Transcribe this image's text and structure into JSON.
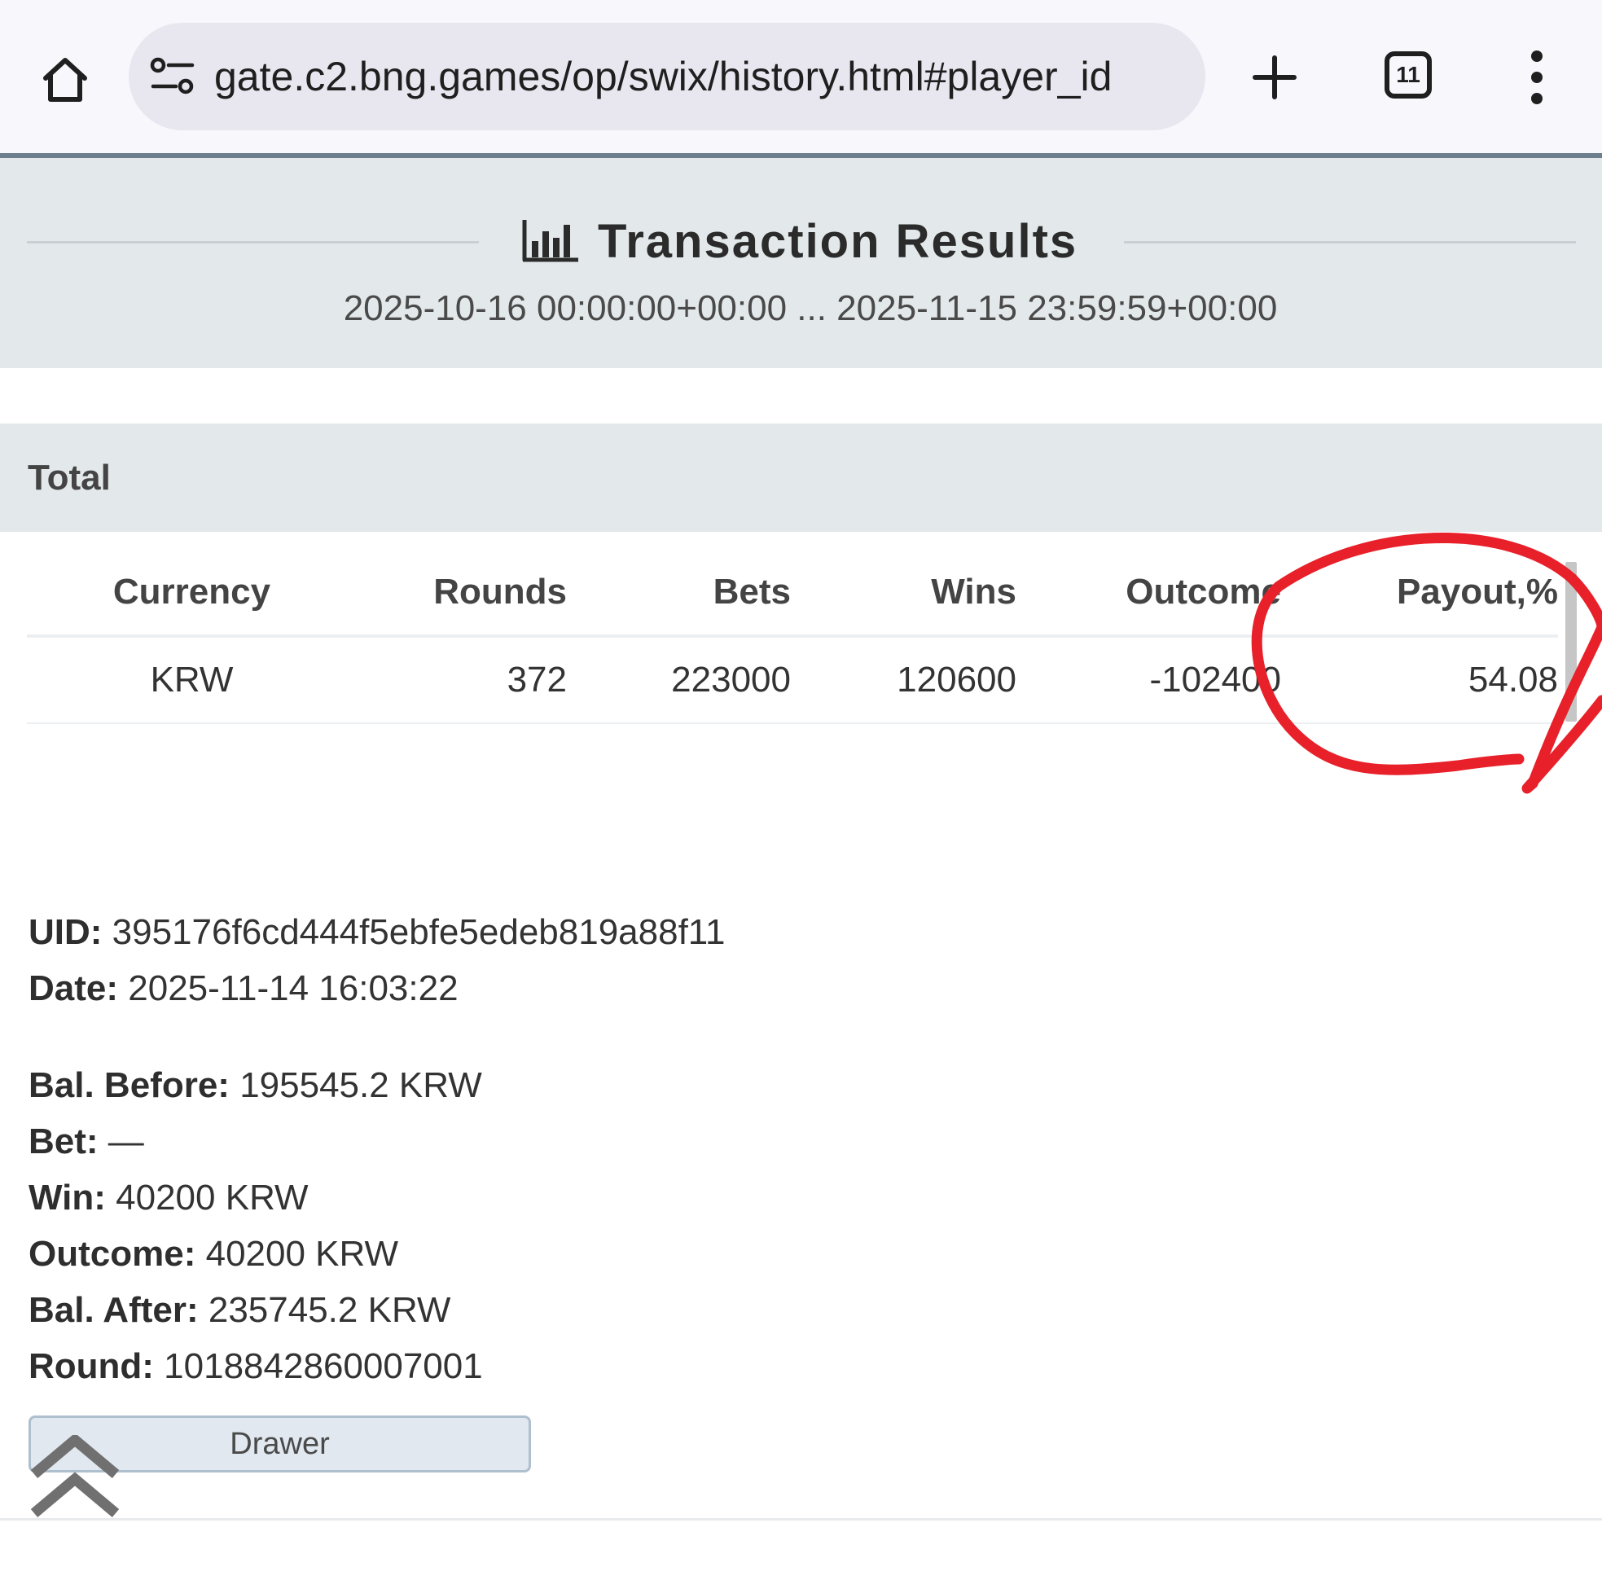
{
  "browser": {
    "url": "gate.c2.bng.games/op/swix/history.html#player_id",
    "tab_count": "11",
    "icons": [
      "home-icon",
      "tune-icon",
      "plus-icon",
      "tab-switcher-icon",
      "more-vert-icon"
    ]
  },
  "header": {
    "title": "Transaction Results",
    "date_range": "2025-10-16 00:00:00+00:00 ... 2025-11-15 23:59:59+00:00",
    "icon": "bar-chart-icon"
  },
  "total": {
    "label": "Total",
    "columns": [
      "Currency",
      "Rounds",
      "Bets",
      "Wins",
      "Outcome",
      "Payout,%"
    ],
    "row": {
      "currency": "KRW",
      "rounds": "372",
      "bets": "223000",
      "wins": "120600",
      "outcome": "-102400",
      "payout": "54.08"
    }
  },
  "transaction": {
    "uid_label": "UID:",
    "uid": "395176f6cd444f5ebfe5edeb819a88f11",
    "date_label": "Date:",
    "date": "2025-11-14 16:03:22",
    "bal_before_label": "Bal. Before:",
    "bal_before": "195545.2 KRW",
    "bet_label": "Bet:",
    "bet": "—",
    "win_label": "Win:",
    "win": "40200 KRW",
    "outcome_label": "Outcome:",
    "outcome": "40200 KRW",
    "bal_after_label": "Bal. After:",
    "bal_after": "235745.2 KRW",
    "round_label": "Round:",
    "round": "1018842860007001",
    "drawer_label": "Drawer"
  },
  "colors": {
    "header_bg": "#e3e8ea",
    "annotation": "#e8202a",
    "drawer_bg": "#e1e8ef"
  }
}
